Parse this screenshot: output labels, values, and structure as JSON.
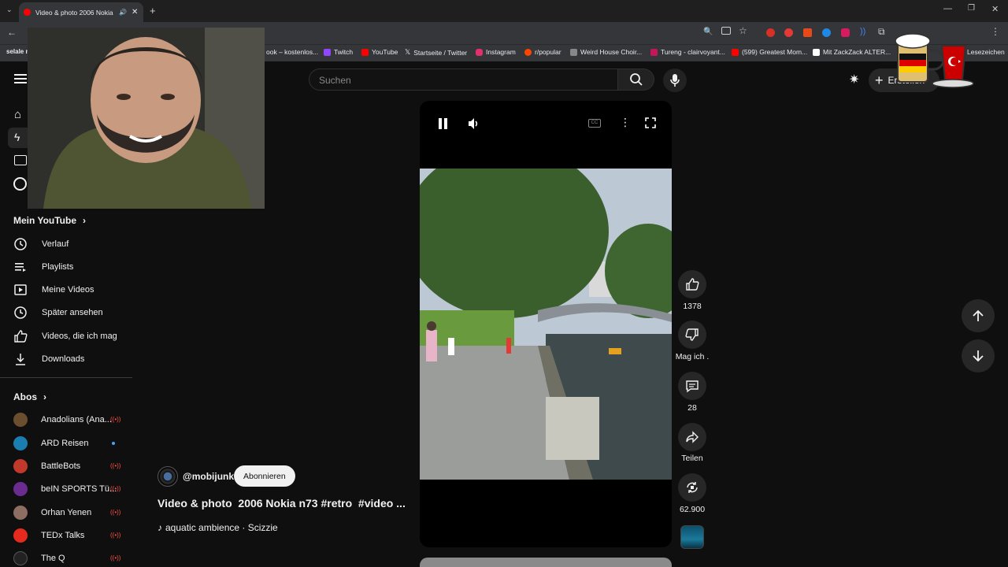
{
  "browser": {
    "tab_title": "Video & photo 2006 Nokia",
    "bookmarks": [
      {
        "label": "selale n",
        "color": "#8ab4f8"
      },
      {
        "label": "ook – kostenlos...",
        "color": "#999999"
      },
      {
        "label": "Twitch",
        "color": "#9146ff"
      },
      {
        "label": "YouTube",
        "color": "#ff0000"
      },
      {
        "label": "Startseite / Twitter",
        "color": "#ffffff"
      },
      {
        "label": "Instagram",
        "color": "#e1306c"
      },
      {
        "label": "r/popular",
        "color": "#ff4500"
      },
      {
        "label": "Weird House Choir...",
        "color": "#cccccc"
      },
      {
        "label": "Tureng - clairvoyant...",
        "color": "#c2185b"
      },
      {
        "label": "(599) Greatest Mom...",
        "color": "#ff0000"
      },
      {
        "label": "Mit ZackZack ALTER...",
        "color": "#ffffff"
      },
      {
        "label": "Lesezeichen",
        "color": "#e8eaed"
      }
    ]
  },
  "search": {
    "placeholder": "Suchen"
  },
  "header": {
    "create_label": "Erstellen"
  },
  "sidebar": {
    "my_youtube_label": "Mein YouTube",
    "items": [
      {
        "label": "Verlauf",
        "icon": "history-icon"
      },
      {
        "label": "Playlists",
        "icon": "playlist-icon"
      },
      {
        "label": "Meine Videos",
        "icon": "my-videos-icon"
      },
      {
        "label": "Später ansehen",
        "icon": "watch-later-icon"
      },
      {
        "label": "Videos, die ich mag",
        "icon": "like-icon"
      },
      {
        "label": "Downloads",
        "icon": "download-icon"
      }
    ],
    "subs_label": "Abos",
    "subs": [
      {
        "label": "Anadolians (Ana...",
        "color": "#6b4e2e",
        "indicator": "live"
      },
      {
        "label": "ARD Reisen",
        "color": "#1a7fb0",
        "indicator": "dot"
      },
      {
        "label": "BattleBots",
        "color": "#c0392b",
        "indicator": "live"
      },
      {
        "label": "beIN SPORTS Tü...",
        "color": "#6a2c91",
        "indicator": "live"
      },
      {
        "label": "Orhan Yenen",
        "color": "#8d6e63",
        "indicator": "live"
      },
      {
        "label": "TEDx Talks",
        "color": "#e62b1e",
        "indicator": "live"
      },
      {
        "label": "The Q",
        "color": "#222222",
        "indicator": "live"
      }
    ]
  },
  "short": {
    "channel": "@mobijunk",
    "subscribe_label": "Abonnieren",
    "title": "Video & photo  2006 Nokia n73 #retro  #video ...",
    "music": "aquatic ambience · Scizzie"
  },
  "actions": {
    "likes": "1378",
    "dislike_label": "Mag ich .",
    "comments": "28",
    "share_label": "Teilen",
    "remix": "62.900"
  }
}
